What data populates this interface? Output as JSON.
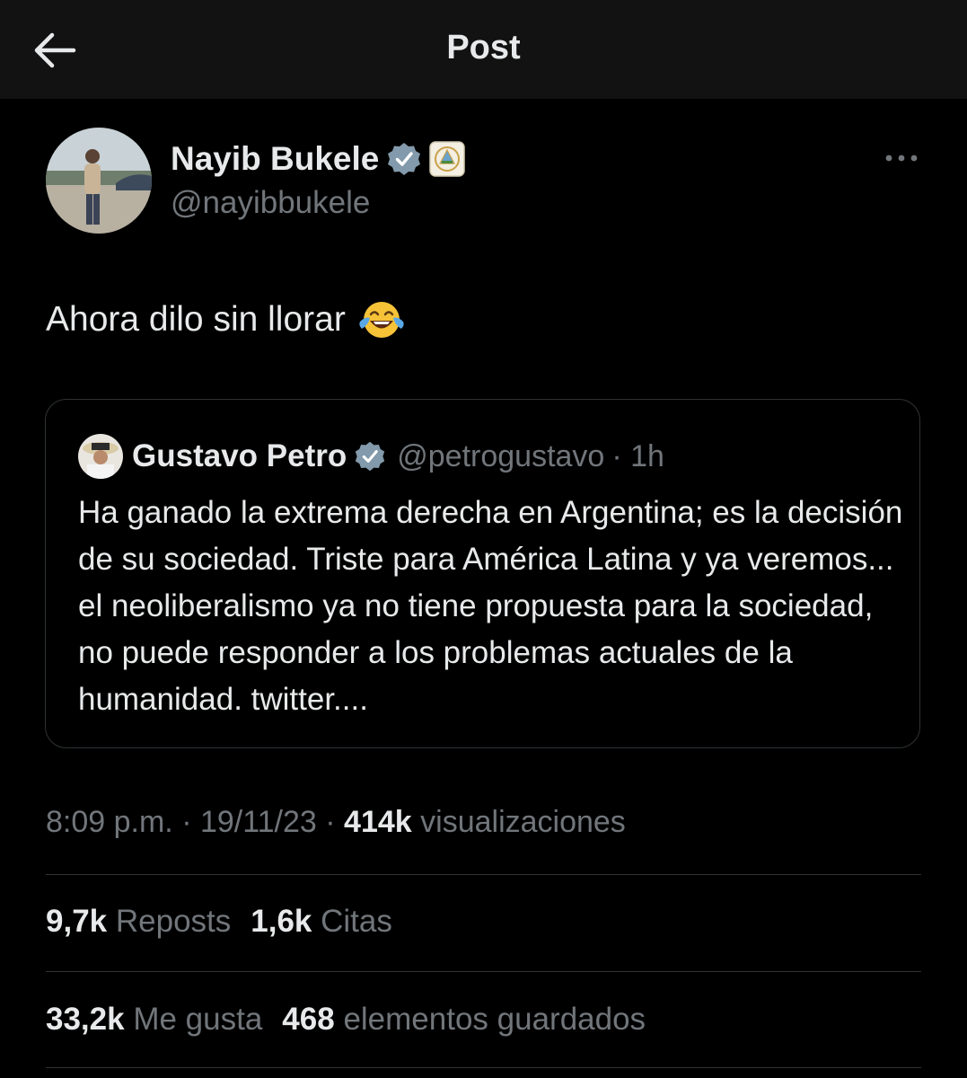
{
  "header": {
    "title": "Post"
  },
  "author": {
    "name": "Nayib Bukele",
    "handle": "@nayibbukele"
  },
  "post": {
    "text": "Ahora dilo sin llorar"
  },
  "quoted": {
    "name": "Gustavo Petro",
    "handle": "@petrogustavo",
    "time": "· 1h",
    "text": "Ha ganado la extrema derecha en Argentina; es la decisión de su sociedad. Triste para América Latina y ya veremos... el neoliberalismo ya no tiene propuesta para la sociedad, no puede responder a los problemas actuales de la humanidad. twitter...."
  },
  "meta": {
    "time": "8:09 p.m.",
    "sep1": "·",
    "date": "19/11/23",
    "sep2": "·",
    "views": "414k",
    "views_label": "visualizaciones"
  },
  "stats": {
    "reposts": "9,7k",
    "reposts_label": "Reposts",
    "quotes": "1,6k",
    "quotes_label": "Citas",
    "likes": "33,2k",
    "likes_label": "Me gusta",
    "bookmarks": "468",
    "bookmarks_label": "elementos guardados"
  },
  "colors": {
    "background": "#000000",
    "header_bg": "#121212",
    "text": "#e7e9ea",
    "muted": "#71767b",
    "verified": "#829aab",
    "border": "#2f3336"
  },
  "icons": [
    "back-arrow-icon",
    "verified-badge-icon",
    "el-salvador-seal-icon",
    "more-icon",
    "laughing-tears-emoji"
  ]
}
